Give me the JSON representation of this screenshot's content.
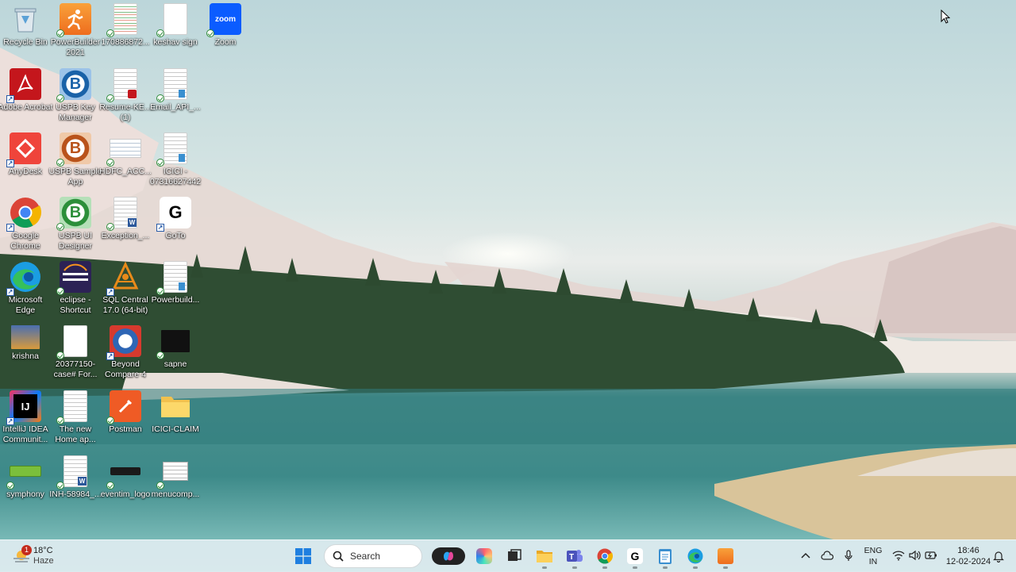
{
  "desktop": {
    "icons": [
      {
        "label": "Recycle Bin"
      },
      {
        "label": "PowerBuilder 2021"
      },
      {
        "label": "170886872..."
      },
      {
        "label": "keshav sign"
      },
      {
        "label": "Zoom"
      },
      {
        "label": "Adobe Acrobat"
      },
      {
        "label": "USPB Key Manager"
      },
      {
        "label": "Resume-KE... (1)"
      },
      {
        "label": "Email_API_..."
      },
      {
        "label": "AnyDesk"
      },
      {
        "label": "USPB Sample App"
      },
      {
        "label": "HDFC_ACC..."
      },
      {
        "label": "ICICI - 07316627442"
      },
      {
        "label": "Google Chrome"
      },
      {
        "label": "USPB UI Designer"
      },
      {
        "label": "Exception_..."
      },
      {
        "label": "GoTo"
      },
      {
        "label": "Microsoft Edge"
      },
      {
        "label": "eclipse - Shortcut"
      },
      {
        "label": "SQL Central 17.0 (64-bit)"
      },
      {
        "label": "Powerbuild..."
      },
      {
        "label": "krishna"
      },
      {
        "label": "20377150-case# For..."
      },
      {
        "label": "Beyond Compare 4"
      },
      {
        "label": "sapne"
      },
      {
        "label": "IntelliJ IDEA Communit..."
      },
      {
        "label": "The new Home ap..."
      },
      {
        "label": "Postman"
      },
      {
        "label": "ICICI-CLAIM"
      },
      {
        "label": "symphony"
      },
      {
        "label": "INH-58984_..."
      },
      {
        "label": "eventim_logo"
      },
      {
        "label": "menucomp..."
      }
    ]
  },
  "taskbar": {
    "weather": {
      "temp": "18°C",
      "condition": "Haze",
      "badge": "1"
    },
    "search_placeholder": "Search",
    "apps": [
      {
        "icon": "windows-start-icon"
      },
      {
        "icon": "copilot-icon"
      },
      {
        "icon": "photoshop-icon"
      },
      {
        "icon": "task-view-icon"
      },
      {
        "icon": "file-explorer-icon"
      },
      {
        "icon": "teams-icon"
      },
      {
        "icon": "chrome-icon"
      },
      {
        "icon": "goto-icon"
      },
      {
        "icon": "notepad-icon"
      },
      {
        "icon": "edge-icon"
      },
      {
        "icon": "powerbuilder-icon"
      }
    ],
    "language": {
      "line1": "ENG",
      "line2": "IN"
    },
    "clock": {
      "time": "18:46",
      "date": "12-02-2024"
    }
  }
}
